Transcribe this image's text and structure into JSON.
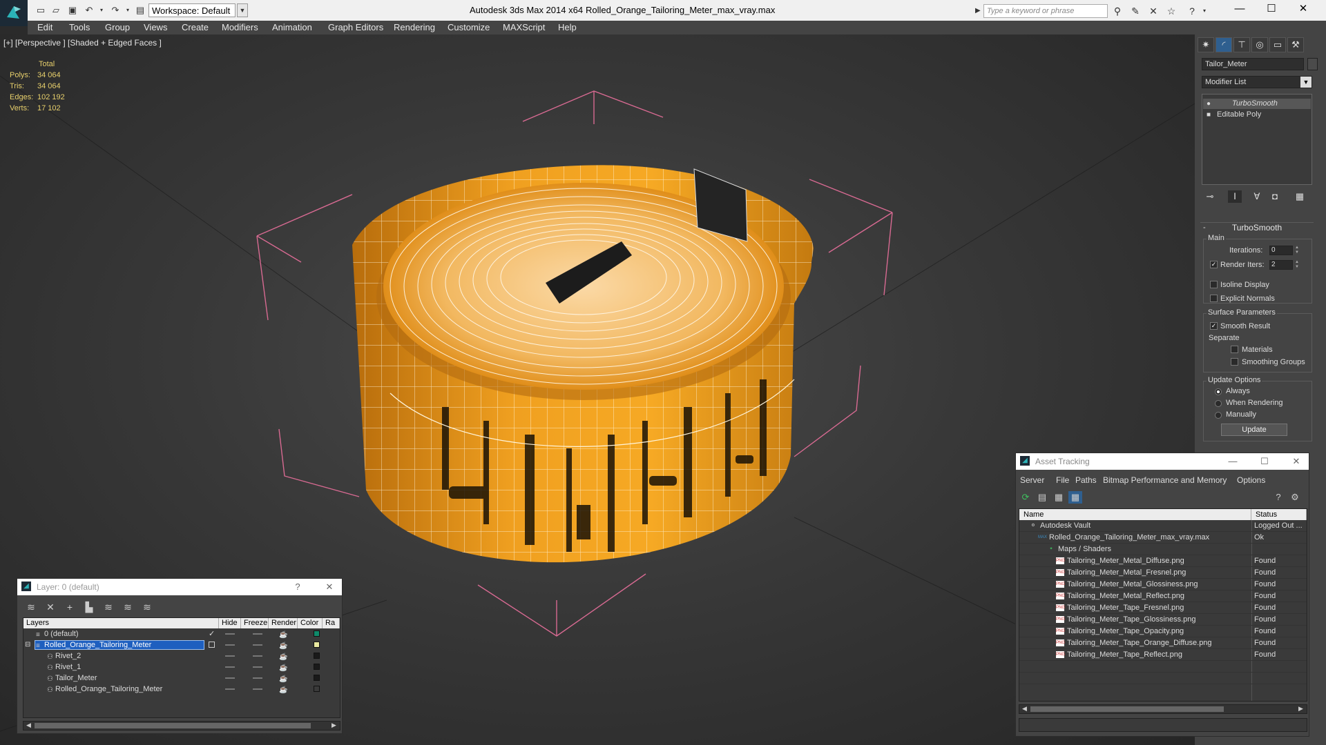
{
  "titlebar": {
    "workspace_label": "Workspace: Default",
    "app_title": "Autodesk 3ds Max  2014 x64",
    "file_title": "Rolled_Orange_Tailoring_Meter_max_vray.max",
    "search_placeholder": "Type a keyword or phrase"
  },
  "menu": [
    "Edit",
    "Tools",
    "Group",
    "Views",
    "Create",
    "Modifiers",
    "Animation",
    "Graph Editors",
    "Rendering",
    "Customize",
    "MAXScript",
    "Help"
  ],
  "viewport": {
    "label": "[+] [Perspective ] [Shaded + Edged Faces ]",
    "stats": {
      "header": "Total",
      "rows": [
        {
          "label": "Polys:",
          "value": "34 064"
        },
        {
          "label": "Tris:",
          "value": "34 064"
        },
        {
          "label": "Edges:",
          "value": "102 192"
        },
        {
          "label": "Verts:",
          "value": "17 102"
        }
      ]
    }
  },
  "command_panel": {
    "object_name": "Tailor_Meter",
    "modifier_list": "Modifier List",
    "stack": [
      "TurboSmooth",
      "Editable Poly"
    ],
    "rollout_title": "TurboSmooth",
    "main_group": "Main",
    "iterations_label": "Iterations:",
    "iterations_value": "0",
    "render_iters_label": "Render Iters:",
    "render_iters_value": "2",
    "isoline_label": "Isoline Display",
    "explicit_label": "Explicit Normals",
    "surface_group": "Surface Parameters",
    "smooth_result_label": "Smooth Result",
    "separate_label": "Separate",
    "materials_label": "Materials",
    "smoothing_groups_label": "Smoothing Groups",
    "update_group": "Update Options",
    "always_label": "Always",
    "when_rendering_label": "When Rendering",
    "manually_label": "Manually",
    "update_button": "Update"
  },
  "layer_window": {
    "title": "Layer: 0 (default)",
    "help": "?",
    "columns": [
      "Layers",
      "Hide",
      "Freeze",
      "Render",
      "Color",
      "Ra"
    ],
    "rows": [
      {
        "name": "0 (default)",
        "color": "#0f8a6a",
        "checked": "✓"
      },
      {
        "name": "Rolled_Orange_Tailoring_Meter",
        "color": "#e8e8a0",
        "selected": true
      },
      {
        "name": "Rivet_2",
        "color": "#1a1a1a"
      },
      {
        "name": "Rivet_1",
        "color": "#1a1a1a"
      },
      {
        "name": "Tailor_Meter",
        "color": "#1a1a1a"
      },
      {
        "name": "Rolled_Orange_Tailoring_Meter",
        "color": "#3a3a3a"
      }
    ]
  },
  "asset_window": {
    "title": "Asset Tracking",
    "menu": [
      "Server",
      "File",
      "Paths",
      "Bitmap Performance and Memory",
      "Options"
    ],
    "columns": [
      "Name",
      "Status"
    ],
    "rows": [
      {
        "name": "Autodesk Vault",
        "status": "Logged Out ...",
        "indent": 0,
        "icon": "vault"
      },
      {
        "name": "Rolled_Orange_Tailoring_Meter_max_vray.max",
        "status": "Ok",
        "indent": 1,
        "icon": "max"
      },
      {
        "name": "Maps / Shaders",
        "status": "",
        "indent": 2,
        "icon": "maps"
      },
      {
        "name": "Tailoring_Meter_Metal_Diffuse.png",
        "status": "Found",
        "indent": 3,
        "icon": "png"
      },
      {
        "name": "Tailoring_Meter_Metal_Fresnel.png",
        "status": "Found",
        "indent": 3,
        "icon": "png"
      },
      {
        "name": "Tailoring_Meter_Metal_Glossiness.png",
        "status": "Found",
        "indent": 3,
        "icon": "png"
      },
      {
        "name": "Tailoring_Meter_Metal_Reflect.png",
        "status": "Found",
        "indent": 3,
        "icon": "png"
      },
      {
        "name": "Tailoring_Meter_Tape_Fresnel.png",
        "status": "Found",
        "indent": 3,
        "icon": "png"
      },
      {
        "name": "Tailoring_Meter_Tape_Glossiness.png",
        "status": "Found",
        "indent": 3,
        "icon": "png"
      },
      {
        "name": "Tailoring_Meter_Tape_Opacity.png",
        "status": "Found",
        "indent": 3,
        "icon": "png"
      },
      {
        "name": "Tailoring_Meter_Tape_Orange_Diffuse.png",
        "status": "Found",
        "indent": 3,
        "icon": "png"
      },
      {
        "name": "Tailoring_Meter_Tape_Reflect.png",
        "status": "Found",
        "indent": 3,
        "icon": "png"
      }
    ]
  },
  "colors": {
    "tape_orange": "#f2a020",
    "wire": "#f5efd8",
    "selection_blue": "#1e5fbf",
    "bbox": "#e06a9a"
  }
}
